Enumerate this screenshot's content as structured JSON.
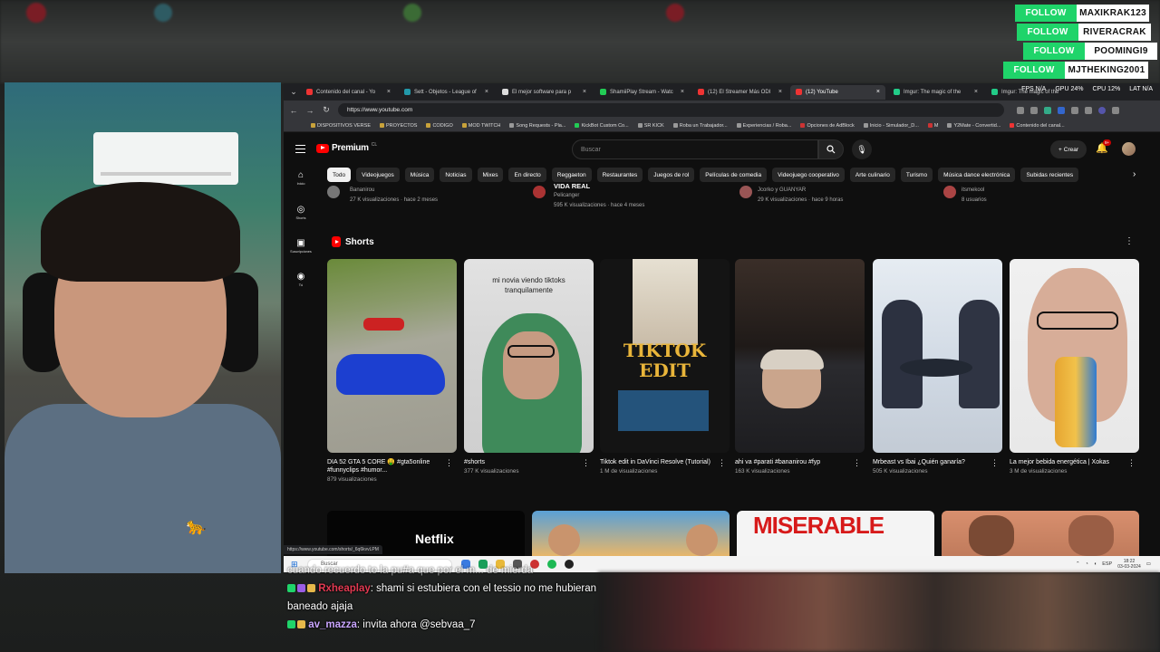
{
  "follow_overlay": [
    {
      "button": "FOLLOW",
      "name": "MAXIKRAK123"
    },
    {
      "button": "FOLLOW",
      "name": "RIVERACRAK"
    },
    {
      "button": "FOLLOW",
      "name": "POOMINGI9"
    },
    {
      "button": "FOLLOW",
      "name": "MJTHEKING2001"
    }
  ],
  "system_stats": {
    "fps": "FPS N/A",
    "gpu": "GPU 24%",
    "cpu": "CPU 12%",
    "lat": "LAT N/A"
  },
  "browser": {
    "tabs": [
      {
        "label": "Contenido del canal - Yo",
        "color": "#e33"
      },
      {
        "label": "Sett - Objetos - League of",
        "color": "#29a"
      },
      {
        "label": "El mejor software para p",
        "color": "#ddd"
      },
      {
        "label": "ShamiiPlay Stream - Watc",
        "color": "#2c5"
      },
      {
        "label": "(12) El Streamer Más ODI",
        "color": "#e33"
      },
      {
        "label": "(12) YouTube",
        "color": "#e33"
      },
      {
        "label": "Imgur: The magic of the",
        "color": "#2c8"
      },
      {
        "label": "Imgur: The magic of the",
        "color": "#2c8"
      }
    ],
    "url": "https://www.youtube.com",
    "bookmarks": [
      "DISPOSITIVOS VERSE",
      "PROYECTOS",
      "CODIGO",
      "MOD TWITCH",
      "Song Requests - Pla...",
      "KickBot Custom Co...",
      "SR KICK",
      "Roba un Trabajador...",
      "Experiencias / Roba...",
      "Opciones de AdBlock",
      "Inicio - Simulador_D...",
      "M",
      "Y2Mate - Convertid...",
      "Contenido del canal..."
    ],
    "status_url": "https://www.youtube.com/shorts/_6q6kvvLPM"
  },
  "youtube": {
    "logo": "Premium",
    "logo_cc": "CL",
    "search_placeholder": "Buscar",
    "create_label": "Crear",
    "notif_count": "9+",
    "sidebar": [
      {
        "icon": "⌂",
        "label": "Inicio"
      },
      {
        "icon": "◎",
        "label": "Shorts"
      },
      {
        "icon": "▣",
        "label": "Suscripciones"
      },
      {
        "icon": "◉",
        "label": "Tú"
      }
    ],
    "chips": [
      "Todo",
      "Videojuegos",
      "Música",
      "Noticias",
      "Mixes",
      "En directo",
      "Reggaeton",
      "Restaurantes",
      "Juegos de rol",
      "Películas de comedia",
      "Videojuego cooperativo",
      "Arte culinario",
      "Turismo",
      "Música dance electrónica",
      "Subidas recientes"
    ],
    "prev_row": [
      {
        "title": "",
        "channel": "Bananirou",
        "meta": "27 K visualizaciones · hace 2 meses"
      },
      {
        "title": "VIDA REAL",
        "channel": "Pelicanger",
        "meta": "595 K visualizaciones · hace 4 meses"
      },
      {
        "title": "",
        "channel": "Jcorko y GUANYAR",
        "meta": "29 K visualizaciones · hace 9 horas"
      },
      {
        "title": "",
        "channel": "itsmekool",
        "meta": "8 usuarios"
      }
    ],
    "shorts_title": "Shorts",
    "shorts": [
      {
        "title": "DIA 52 GTA 5 CORE 🤑 #gta5online #funnyclips #humor...",
        "views": "879 visualizaciones"
      },
      {
        "title": "#shorts",
        "views": "377 K visualizaciones",
        "overlay": "mi novia viendo tiktoks tranquilamente"
      },
      {
        "title": "Tiktok edit in DaVinci Resolve (Tutorial)",
        "views": "1 M de visualizaciones",
        "overlay": "TIKTOK EDIT"
      },
      {
        "title": "ahi va #parati #bananirou #fyp",
        "views": "163 K visualizaciones"
      },
      {
        "title": "Mrbeast vs Ibai ¿Quién ganaría?",
        "views": "505 K visualizaciones"
      },
      {
        "title": "La mejor bebida energética | Xokas",
        "views": "3 M de visualizaciones"
      }
    ],
    "row2": [
      {
        "text": "Netflix"
      },
      {
        "text": ""
      },
      {
        "text": "MISERABLE"
      },
      {
        "text": ""
      }
    ]
  },
  "taskbar": {
    "search": "Buscar",
    "lang": "ESP",
    "time": "18:22",
    "date": "03-03-2024"
  },
  "chat": [
    {
      "user": "",
      "text": "cuando recuerdo to la pu#a que por el m... de mierda"
    },
    {
      "user": "Rxheaplay",
      "text": ": shami si estubiera con el tessio no me hubieran baneado ajaja"
    },
    {
      "user": "av_mazza",
      "text": ": invita ahora @sebvaa_7"
    }
  ],
  "colors": {
    "yt_red": "#ff0000",
    "follow_green": "#1fd46a"
  }
}
